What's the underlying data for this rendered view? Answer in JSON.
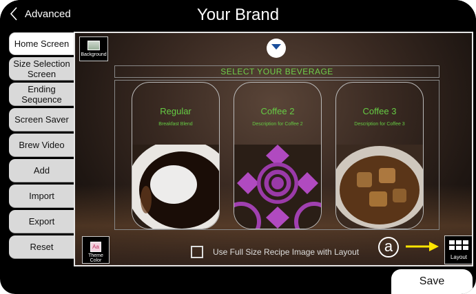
{
  "header": {
    "back_label": "Advanced",
    "title": "Your Brand"
  },
  "sidebar": {
    "items": [
      {
        "label": "Home Screen"
      },
      {
        "label": "Size Selection Screen"
      },
      {
        "label": "Ending Sequence"
      },
      {
        "label": "Screen Saver"
      },
      {
        "label": "Brew Video"
      },
      {
        "label": "Add"
      },
      {
        "label": "Import"
      },
      {
        "label": "Export"
      },
      {
        "label": "Reset"
      }
    ]
  },
  "preview": {
    "background_label": "Background",
    "select_heading": "SELECT YOUR BEVERAGE",
    "cards": [
      {
        "name": "Regular",
        "description": "Breakfast Blend"
      },
      {
        "name": "Coffee 2",
        "description": "Description for Coffee 2"
      },
      {
        "name": "Coffee 3",
        "description": "Description for Coffee 3"
      }
    ],
    "theme_label": "Theme Color",
    "full_size_label": "Use Full Size Recipe Image with Layout",
    "callout": "a",
    "layout_label": "Layout",
    "accent_green": "#66cc44",
    "arrow_color": "#ffe600"
  },
  "footer": {
    "save_label": "Save"
  }
}
